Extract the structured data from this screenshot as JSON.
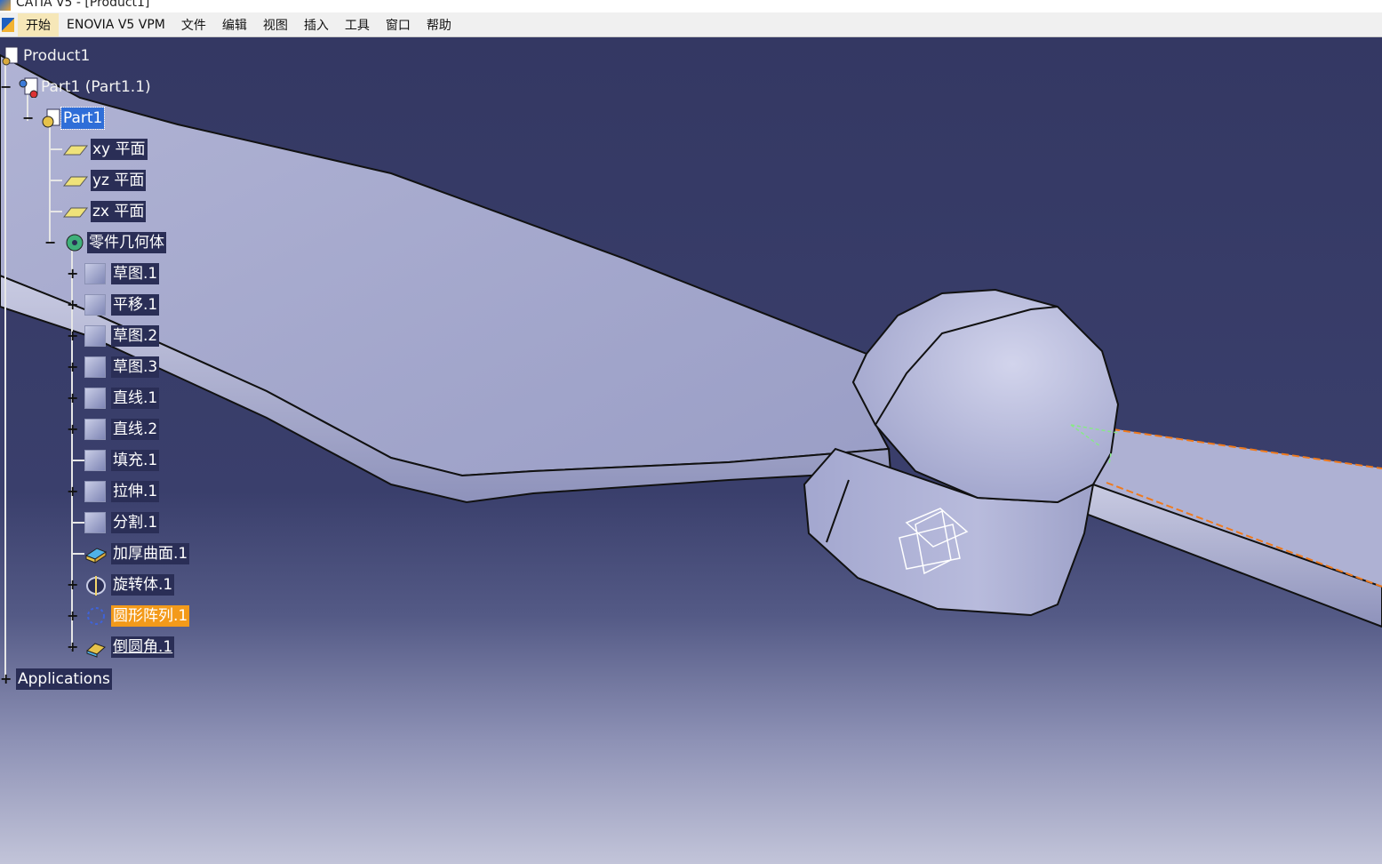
{
  "window": {
    "title": "CATIA V5 - [Product1]"
  },
  "menubar": {
    "items": [
      "开始",
      "ENOVIA V5 VPM",
      "文件",
      "编辑",
      "视图",
      "插入",
      "工具",
      "窗口",
      "帮助"
    ]
  },
  "tree": {
    "root": "Product1",
    "part_instance": "Part1 (Part1.1)",
    "part": "Part1",
    "planes": [
      "xy 平面",
      "yz 平面",
      "zx 平面"
    ],
    "body": "零件几何体",
    "features": [
      "草图.1",
      "平移.1",
      "草图.2",
      "草图.3",
      "直线.1",
      "直线.2",
      "填充.1",
      "拉伸.1",
      "分割.1",
      "加厚曲面.1",
      "旋转体.1",
      "圆形阵列.1",
      "倒圆角.1"
    ],
    "applications": "Applications"
  },
  "colors": {
    "background_top": "#343863",
    "background_bottom": "#c2c4d9",
    "selection": "#2f6ed8",
    "highlight": "#f39a1a",
    "model_surface": "#a5a8cc"
  }
}
